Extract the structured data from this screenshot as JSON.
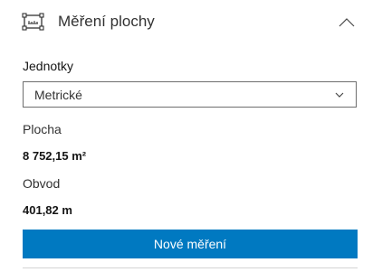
{
  "panel": {
    "title": "Měření plochy",
    "icon": "area-measure-icon",
    "collapse_icon": "chevron-up-icon"
  },
  "units": {
    "label": "Jednotky",
    "selected": "Metrické",
    "chevron_icon": "chevron-down-icon"
  },
  "results": {
    "area_label": "Plocha",
    "area_value": "8 752,15 m²",
    "perimeter_label": "Obvod",
    "perimeter_value": "401,82 m"
  },
  "actions": {
    "new_measurement_label": "Nové měření"
  },
  "colors": {
    "accent": "#0079c1",
    "text": "#323232",
    "border": "#6e6e6e"
  }
}
